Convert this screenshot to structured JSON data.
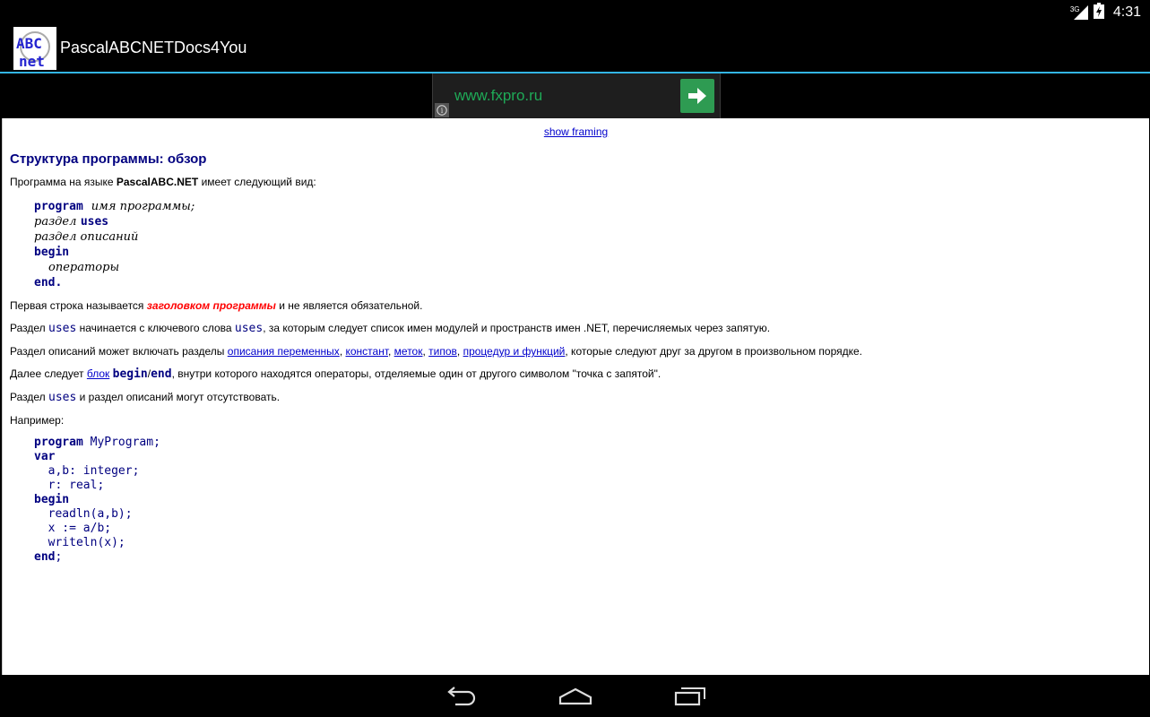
{
  "status_bar": {
    "network": "3G",
    "time": "4:31"
  },
  "action_bar": {
    "app_title": "PascalABCNETDocs4You",
    "icon_text_top": "ABC",
    "icon_text_bottom": "net"
  },
  "ad": {
    "url": "www.fxpro.ru",
    "info": "i"
  },
  "content": {
    "show_framing": "show framing",
    "title": "Структура программы: обзор",
    "intro": {
      "before": "Программа на языке ",
      "strong": "PascalABC.NET",
      "after": " имеет следующий вид:"
    },
    "structure": {
      "program_kw": "program",
      "program_name": "имя программы",
      "semicolon": ";",
      "section": "раздел",
      "uses_kw": "uses",
      "declarations": "раздел описаний",
      "begin_kw": "begin",
      "statements": "операторы",
      "end_kw": "end."
    },
    "para_header": {
      "before": "Первая строка называется ",
      "emph": "заголовком программы",
      "after": " и не является обязательной."
    },
    "para_uses": {
      "before": "Раздел ",
      "kw1": "uses",
      "middle": " начинается с ключевого слова ",
      "kw2": "uses",
      "after": ", за которым следует список имен модулей и пространств имен .NET, перечисляемых через запятую."
    },
    "para_decl": {
      "before": "Раздел описаний может включать разделы ",
      "links": [
        "описания переменных",
        "констант",
        "меток",
        "типов",
        "процедур и функций"
      ],
      "sep": ", ",
      "after": ", которые следуют друг за другом в произвольном порядке."
    },
    "para_block": {
      "before": "Далее следует ",
      "link": "блок",
      "space": " ",
      "kw_begin": "begin",
      "slash": "/",
      "kw_end": "end",
      "after": ", внутри которого находятся операторы, отделяемые один от другого символом \"точка с запятой\"."
    },
    "para_optional": {
      "before": "Раздел ",
      "kw": "uses",
      "after": " и раздел описаний могут отсутствовать."
    },
    "example_label": "Например:",
    "example": {
      "l1_kw": "program",
      "l1_rest": " MyProgram;",
      "l2_kw": "var",
      "l3": "  a,b: integer;",
      "l4": "  r: real;",
      "l5_kw": "begin",
      "l6": "  readln(a,b);",
      "l7": "  x := a/b;",
      "l8": "  writeln(x);",
      "l9_kw": "end",
      "l9_rest": ";"
    }
  }
}
